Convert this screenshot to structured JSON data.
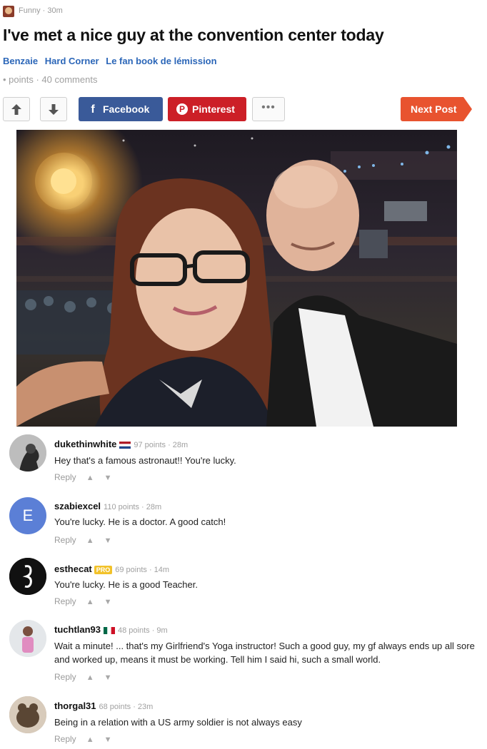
{
  "header": {
    "section_meta": "Funny · 30m",
    "title": "I've met a nice guy at the convention center today",
    "tags": [
      "Benzaie",
      "Hard Corner",
      "Le fan book de lémission"
    ],
    "stats": "• points · 40 comments"
  },
  "actions": {
    "facebook_label": "Facebook",
    "pinterest_label": "Pinterest",
    "more_label": "•••",
    "next_label": "Next Post"
  },
  "comments": [
    {
      "author": "dukethinwhite",
      "meta": "97 points · 28m",
      "text": "Hey that's a famous astronaut!! You're lucky.",
      "reply": "Reply"
    },
    {
      "author": "szabiexcel",
      "avatar_letter": "E",
      "meta": "110 points · 28m",
      "text": "You're lucky. He is a doctor. A good catch!",
      "reply": "Reply"
    },
    {
      "author": "esthecat",
      "badge": "PRO",
      "meta": "69 points · 14m",
      "text": "You're lucky. He is a good Teacher.",
      "reply": "Reply"
    },
    {
      "author": "tuchtlan93",
      "meta": "48 points · 9m",
      "text": "Wait a minute! ... that's my Girlfriend's Yoga instructor! Such a good guy, my gf always ends up all sore and worked up, means it must be working. Tell him I said hi, such a small world.",
      "reply": "Reply"
    },
    {
      "author": "thorgal31",
      "meta": "68 points · 23m",
      "text": "Being in a relation with a US army soldier is not always easy",
      "reply": "Reply"
    }
  ],
  "colors": {
    "link_blue": "#2b66b8",
    "facebook": "#3a5a99",
    "pinterest": "#cc1f27",
    "next_post": "#e8532f",
    "pro_badge": "#f2c22a"
  }
}
